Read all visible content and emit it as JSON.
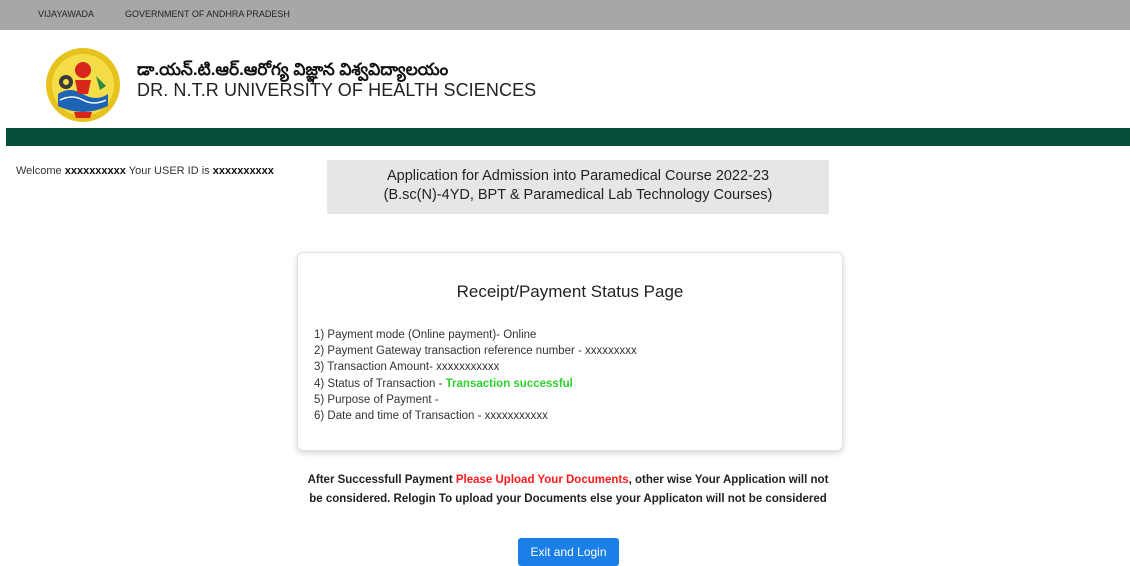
{
  "topbar": {
    "city": "VIJAYAWADA",
    "government": "GOVERNMENT OF ANDHRA PRADESH"
  },
  "header": {
    "university_telugu": "డా.యన్.టి.ఆర్.ఆరోగ్య విజ్ఞాన విశ్వవిద్యాలయం",
    "university_english": "DR. N.T.R UNIVERSITY OF HEALTH SCIENCES"
  },
  "welcome": {
    "prefix": "Welcome",
    "user_name": "xxxxxxxxxx",
    "middle": "Your USER ID is",
    "user_id": "xxxxxxxxxx"
  },
  "application": {
    "title_line1": "Application for Admission into Paramedical Course 2022-23",
    "title_line2": "(B.sc(N)-4YD, BPT & Paramedical Lab Technology Courses)"
  },
  "receipt": {
    "title": "Receipt/Payment Status Page",
    "items": [
      "1) Payment mode (Online payment)- Online",
      "2) Payment Gateway transaction reference number - xxxxxxxxx",
      "3) Transaction Amount- xxxxxxxxxxx",
      "4) Status of Transaction - ",
      "5) Purpose of Payment -",
      "6) Date and time of Transaction - xxxxxxxxxxx"
    ],
    "status_value": "Transaction successful"
  },
  "notice": {
    "before": "After Successfull Payment ",
    "highlight": "Please Upload Your Documents",
    "after": ", other wise Your Application will not be considered. Relogin To upload your Documents else your Applicaton will not be considered"
  },
  "actions": {
    "exit_login_label": "Exit and Login"
  },
  "colors": {
    "green_bar": "#064c3a",
    "success": "#2ed22e",
    "warning": "#ff1a1a",
    "button": "#1a7fe6"
  }
}
